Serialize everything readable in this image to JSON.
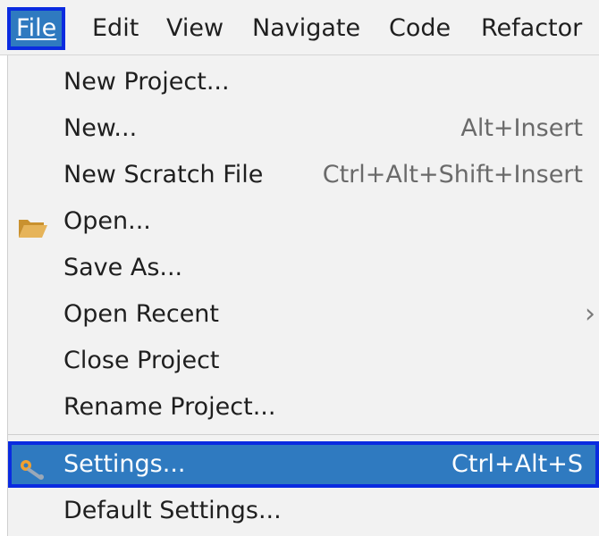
{
  "menubar": {
    "items": [
      {
        "label": "File",
        "active": true
      },
      {
        "label": "Edit"
      },
      {
        "label": "View"
      },
      {
        "label": "Navigate"
      },
      {
        "label": "Code"
      },
      {
        "label": "Refactor"
      }
    ]
  },
  "file_menu": {
    "items": [
      {
        "label": "New Project...",
        "shortcut": ""
      },
      {
        "label": "New...",
        "shortcut": "Alt+Insert"
      },
      {
        "label": "New Scratch File",
        "shortcut": "Ctrl+Alt+Shift+Insert"
      },
      {
        "label": "Open...",
        "shortcut": "",
        "icon": "folder-icon"
      },
      {
        "label": "Save As...",
        "shortcut": ""
      },
      {
        "label": "Open Recent",
        "shortcut": "",
        "submenu_arrow": "›"
      },
      {
        "label": "Close Project",
        "shortcut": ""
      },
      {
        "label": "Rename Project...",
        "shortcut": ""
      },
      {
        "label": "Settings...",
        "shortcut": "Ctrl+Alt+S",
        "icon": "settings-wrench-icon",
        "selected": true
      },
      {
        "label": "Default Settings...",
        "shortcut": ""
      }
    ]
  },
  "colors": {
    "selection": "#2f7ac0",
    "highlight_outline": "#0a2be0",
    "menu_background": "#f2f2f2",
    "shortcut_text": "#6a6a6a",
    "folder_icon": "#e6b45a"
  }
}
